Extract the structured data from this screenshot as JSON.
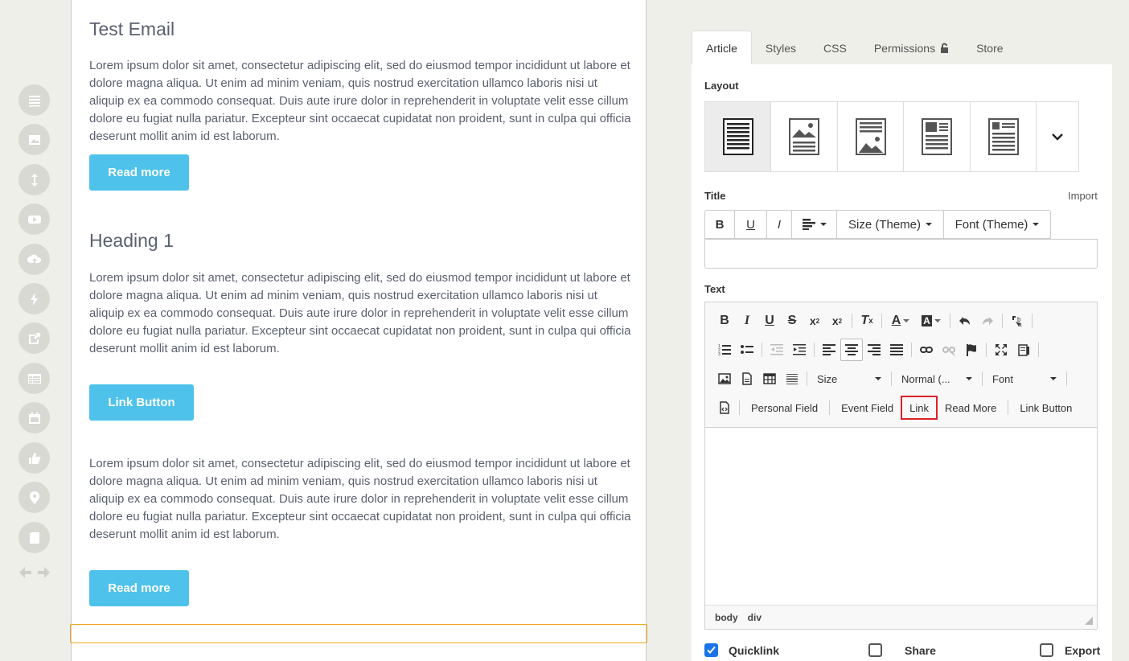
{
  "rail": {
    "items": [
      "text-block-icon",
      "image-block-icon",
      "spacer-icon",
      "video-icon",
      "upload-icon",
      "lightning-icon",
      "share-icon",
      "table-icon",
      "calendar-icon",
      "thumbs-up-icon",
      "location-pin-icon",
      "book-icon"
    ]
  },
  "canvas": {
    "heading1": "Test Email",
    "para1": "Lorem ipsum dolor sit amet, consectetur adipiscing elit, sed do eiusmod tempor incididunt ut labore et dolore magna aliqua. Ut enim ad minim veniam, quis nostrud exercitation ullamco laboris nisi ut aliquip ex ea commodo consequat. Duis aute irure dolor in reprehenderit in voluptate velit esse cillum dolore eu fugiat nulla pariatur. Excepteur sint occaecat cupidatat non proident, sunt in culpa qui officia deserunt mollit anim id est laborum.",
    "button1": "Read more",
    "heading2": "Heading 1",
    "para2": "Lorem ipsum dolor sit amet, consectetur adipiscing elit, sed do eiusmod tempor incididunt ut labore et dolore magna aliqua. Ut enim ad minim veniam, quis nostrud exercitation ullamco laboris nisi ut aliquip ex ea commodo consequat. Duis aute irure dolor in reprehenderit in voluptate velit esse cillum dolore eu fugiat nulla pariatur. Excepteur sint occaecat cupidatat non proident, sunt in culpa qui officia deserunt mollit anim id est laborum.",
    "button2": "Link Button",
    "para3": "Lorem ipsum dolor sit amet, consectetur adipiscing elit, sed do eiusmod tempor incididunt ut labore et dolore magna aliqua. Ut enim ad minim veniam, quis nostrud exercitation ullamco laboris nisi ut aliquip ex ea commodo consequat. Duis aute irure dolor in reprehenderit in voluptate velit esse cillum dolore eu fugiat nulla pariatur. Excepteur sint occaecat cupidatat non proident, sunt in culpa qui officia deserunt mollit anim id est laborum.",
    "button3": "Read more"
  },
  "panel": {
    "tabs": [
      "Article",
      "Styles",
      "CSS",
      "Permissions",
      "Store"
    ],
    "layout_label": "Layout",
    "title_label": "Title",
    "import_label": "Import",
    "title_toolbar": {
      "bold": "B",
      "underline": "U",
      "italic": "I",
      "size": "Size (Theme)",
      "font": "Font (Theme)"
    },
    "text_label": "Text",
    "editor": {
      "size_combo": "Size",
      "format_combo": "Normal (...",
      "font_combo": "Font",
      "chips": [
        "Personal Field",
        "Event Field",
        "Link",
        "Read More",
        "Link Button"
      ],
      "status": [
        "body",
        "div"
      ]
    },
    "options": {
      "quicklink": "Quicklink",
      "share": "Share",
      "export": "Export"
    }
  },
  "colors": {
    "accent_button": "#4ec2ea",
    "highlight": "#d9232a",
    "checkbox": "#1a73e8",
    "drop_zone": "#f0a51c"
  }
}
